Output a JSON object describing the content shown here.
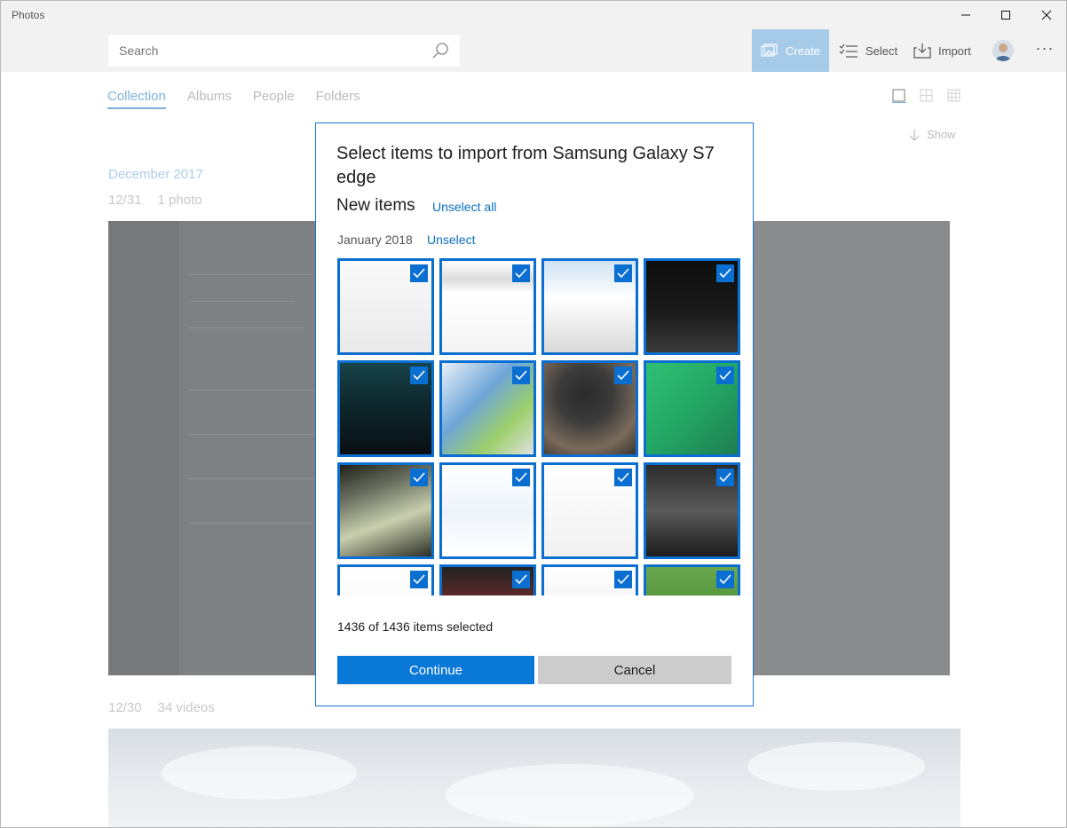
{
  "window": {
    "title": "Photos",
    "controls": [
      "minimize",
      "maximize",
      "close"
    ]
  },
  "commandbar": {
    "search_placeholder": "Search",
    "create_label": "Create",
    "select_label": "Select",
    "import_label": "Import",
    "more_label": "···"
  },
  "tabs": [
    {
      "label": "Collection",
      "active": true
    },
    {
      "label": "Albums",
      "active": false
    },
    {
      "label": "People",
      "active": false
    },
    {
      "label": "Folders",
      "active": false
    }
  ],
  "view": {
    "show_label": "Show"
  },
  "collection": {
    "month": "December 2017",
    "groups": [
      {
        "date": "12/31",
        "count": "1 photo"
      },
      {
        "date": "12/30",
        "count": "34 videos"
      }
    ]
  },
  "dialog": {
    "title": "Select items to import from Samsung Galaxy S7 edge",
    "subtitle": "New items",
    "unselect_all": "Unselect all",
    "group_date": "January 2018",
    "group_unselect": "Unselect",
    "selection_count": "1436 of 1436 items selected",
    "continue_label": "Continue",
    "cancel_label": "Cancel",
    "thumbnails": [
      {
        "name": "screenshot-white-1",
        "selected": true
      },
      {
        "name": "screenshot-white-2",
        "selected": true
      },
      {
        "name": "screenshot-blue-list",
        "selected": true
      },
      {
        "name": "screenshot-dark-text",
        "selected": true
      },
      {
        "name": "screenshot-dark-teal",
        "selected": true
      },
      {
        "name": "screenshot-desktop",
        "selected": true
      },
      {
        "name": "photo-phone-camera",
        "selected": true
      },
      {
        "name": "photo-green-phones",
        "selected": true
      },
      {
        "name": "photo-card",
        "selected": true
      },
      {
        "name": "screenshot-chat",
        "selected": true
      },
      {
        "name": "screenshot-settings",
        "selected": true
      },
      {
        "name": "screenshot-dark-blur",
        "selected": true
      },
      {
        "name": "screenshot-white-3",
        "selected": true
      },
      {
        "name": "screenshot-dark-red",
        "selected": true
      },
      {
        "name": "screenshot-white-4",
        "selected": true
      },
      {
        "name": "photo-grass-box",
        "selected": true
      }
    ]
  },
  "colors": {
    "accent": "#0a78d7",
    "selection_border": "#0a6fd0",
    "create_bg": "#a6cbe9",
    "tab_active": "#3a88c8"
  }
}
